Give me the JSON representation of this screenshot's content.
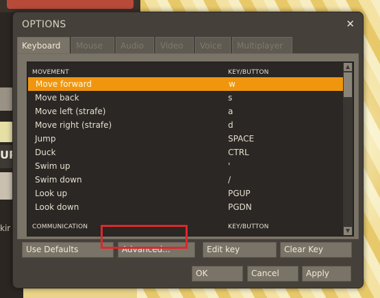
{
  "dialog": {
    "title": "OPTIONS",
    "close_glyph": "✕"
  },
  "tabs": [
    "Keyboard",
    "Mouse",
    "Audio",
    "Video",
    "Voice",
    "Multiplayer"
  ],
  "list": {
    "header": {
      "action": "MOVEMENT",
      "key": "KEY/BUTTON"
    },
    "rows": [
      {
        "action": "Move forward",
        "key": "w"
      },
      {
        "action": "Move back",
        "key": "s"
      },
      {
        "action": "Move left (strafe)",
        "key": "a"
      },
      {
        "action": "Move right (strafe)",
        "key": "d"
      },
      {
        "action": "Jump",
        "key": "SPACE"
      },
      {
        "action": "Duck",
        "key": "CTRL"
      },
      {
        "action": "Swim up",
        "key": "'"
      },
      {
        "action": "Swim down",
        "key": "/"
      },
      {
        "action": "Look up",
        "key": "PGUP"
      },
      {
        "action": "Look down",
        "key": "PGDN"
      }
    ],
    "header2": {
      "action": "COMMUNICATION",
      "key": "KEY/BUTTON"
    },
    "selected_index": 0
  },
  "buttons": {
    "use_defaults": "Use Defaults",
    "advanced": "Advanced...",
    "edit_key": "Edit key",
    "clear_key": "Clear Key",
    "ok": "OK",
    "cancel": "Cancel",
    "apply": "Apply"
  },
  "background": {
    "side_text_1": "UP",
    "side_text_2": "kir"
  },
  "colors": {
    "selection": "#f0960e",
    "highlight_box": "#e0262a",
    "dialog_bg": "#45403a"
  }
}
